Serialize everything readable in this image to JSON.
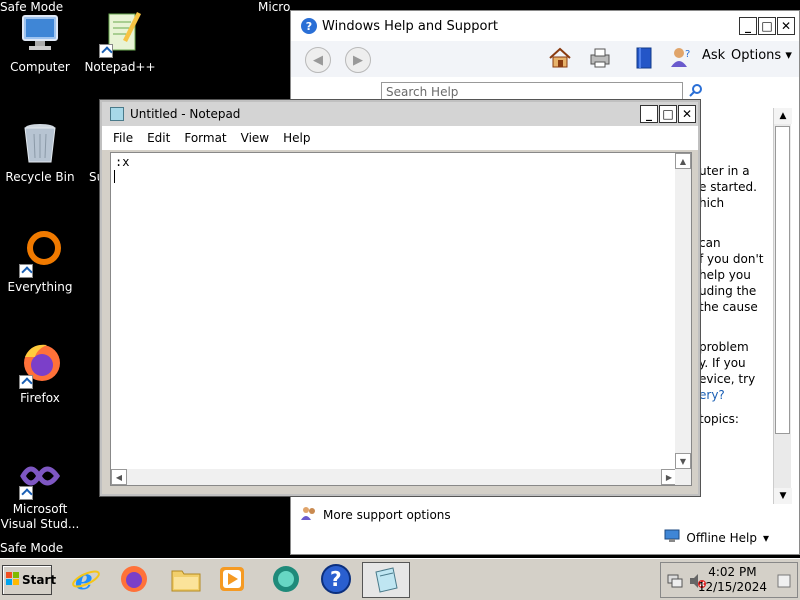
{
  "safe_mode_text": "Safe Mode",
  "desktop_icons": [
    {
      "label": "Computer"
    },
    {
      "label": "Notepad++"
    },
    {
      "label": "Recycle Bin"
    },
    {
      "label": "Su"
    },
    {
      "label": "Everything"
    },
    {
      "label": "Firefox"
    },
    {
      "label": "Microsoft Visual Stud..."
    }
  ],
  "help_window": {
    "title": "Windows Help and Support",
    "ask_label": "Ask",
    "options_label": "Options",
    "search_placeholder": "Search Help",
    "content_lines": [
      {
        "text": "uter in a"
      },
      {
        "text": "e started."
      },
      {
        "text": "hich"
      },
      {
        "text": "can"
      },
      {
        "text": "f you don't"
      },
      {
        "text": "help you"
      },
      {
        "text": "uding the"
      },
      {
        "text": "the cause"
      },
      {
        "text": "problem"
      },
      {
        "text": "y. If you"
      },
      {
        "text": "evice, try"
      },
      {
        "text": "ery?"
      },
      {
        "text": "topics:"
      }
    ],
    "more_support": "More support options",
    "offline_help": "Offline Help"
  },
  "notepad": {
    "title": "Untitled - Notepad",
    "menu": [
      "File",
      "Edit",
      "Format",
      "View",
      "Help"
    ],
    "content": ":x"
  },
  "taskbar": {
    "start_label": "Start",
    "time": "4:02 PM",
    "date": "12/15/2024"
  }
}
